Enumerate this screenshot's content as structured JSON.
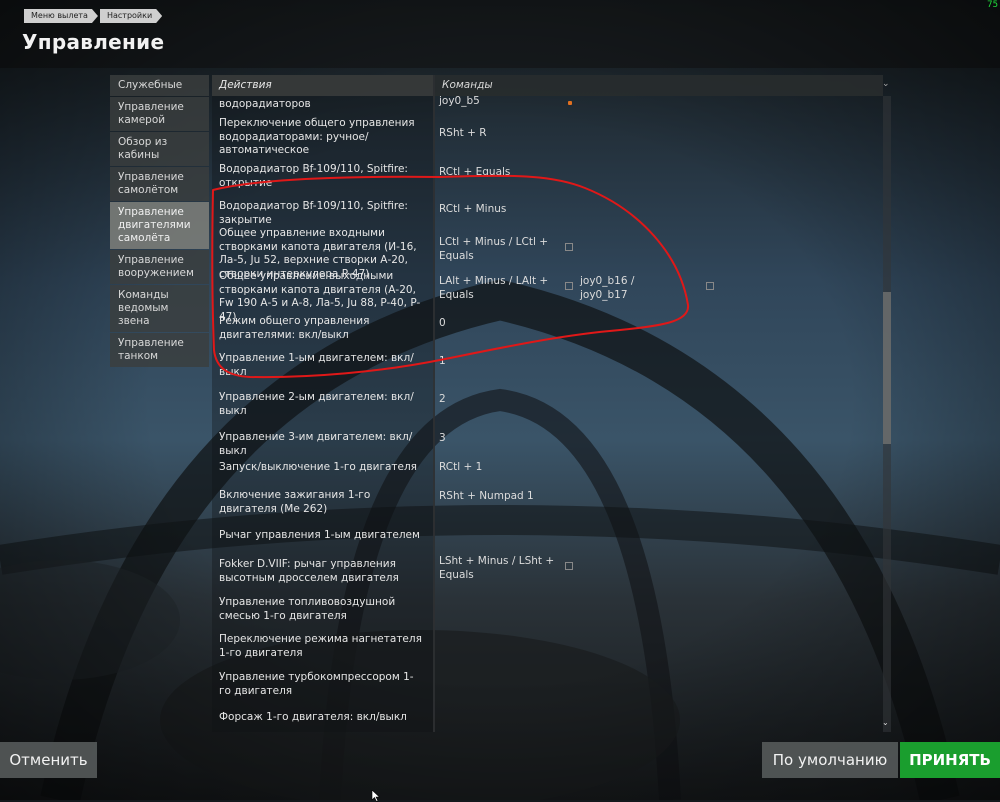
{
  "breadcrumb": [
    "Меню вылета",
    "Настройки"
  ],
  "page_title": "Управление",
  "fps": "75",
  "sidebar": {
    "items": [
      {
        "label": "Служебные",
        "active": false
      },
      {
        "label": "Управление камерой",
        "active": false
      },
      {
        "label": "Обзор из кабины",
        "active": false
      },
      {
        "label": "Управление самолётом",
        "active": false
      },
      {
        "label": "Управление двигателями самолёта",
        "active": true
      },
      {
        "label": "Управление вооружением",
        "active": false
      },
      {
        "label": "Команды ведомым звена",
        "active": false
      },
      {
        "label": "Управление танком",
        "active": false
      }
    ]
  },
  "table": {
    "header_actions": "Действия",
    "header_commands": "Команды",
    "rows": [
      {
        "action": "водорадиаторов",
        "key1": "joy0_b5",
        "key2": ""
      },
      {
        "action": "Переключение общего управления водорадиаторами: ручное/автоматическое",
        "key1": "RSht + R",
        "key2": ""
      },
      {
        "action": "Водорадиатор Bf-109/110, Spitfire: открытие",
        "key1": "RCtl + Equals",
        "key2": ""
      },
      {
        "action": "Водорадиатор Bf-109/110, Spitfire: закрытие",
        "key1": "RCtl + Minus",
        "key2": ""
      },
      {
        "action": "Общее управление входными створками капота двигателя (И-16, Ла-5, Ju 52, верхние створки А-20, створки интеркулера Р-47)",
        "key1": "LCtl + Minus / LCtl + Equals",
        "key2": ""
      },
      {
        "action": "Общее управление выходными створками капота двигателя (А-20, Fw 190 А-5 и А-8, Ла-5, Ju 88, P-40, P-47)",
        "key1": "LAlt + Minus / LAlt + Equals",
        "key2": "joy0_b16 / joy0_b17"
      },
      {
        "action": "Режим общего управления двигателями: вкл/выкл",
        "key1": "0",
        "key2": ""
      },
      {
        "action": "Управление 1-ым двигателем: вкл/выкл",
        "key1": "1",
        "key2": ""
      },
      {
        "action": "Управление 2-ым двигателем: вкл/выкл",
        "key1": "2",
        "key2": ""
      },
      {
        "action": "Управление 3-им двигателем: вкл/выкл",
        "key1": "3",
        "key2": ""
      },
      {
        "action": "Запуск/выключение 1-го двигателя",
        "key1": "RCtl + 1",
        "key2": ""
      },
      {
        "action": "Включение зажигания 1-го двигателя (Me 262)",
        "key1": "RSht + Numpad 1",
        "key2": ""
      },
      {
        "action": "Рычаг управления 1-ым двигателем",
        "key1": "",
        "key2": ""
      },
      {
        "action": "Fokker D.VIIF: рычаг управления высотным дросселем двигателя",
        "key1": "LSht + Minus / LSht + Equals",
        "key2": ""
      },
      {
        "action": "Управление топливовоздушной смесью 1-го двигателя",
        "key1": "",
        "key2": ""
      },
      {
        "action": "Переключение режима нагнетателя 1-го двигателя",
        "key1": "",
        "key2": ""
      },
      {
        "action": "Управление турбокомпрессором 1-го двигателя",
        "key1": "",
        "key2": ""
      },
      {
        "action": "Форсаж 1-го двигателя: вкл/выкл",
        "key1": "",
        "key2": ""
      }
    ]
  },
  "buttons": {
    "cancel": "Отменить",
    "default": "По умолчанию",
    "accept": "ПРИНЯТЬ"
  },
  "colors": {
    "accept_green": "#1a9e2e",
    "annotation_red": "#e01818",
    "fps_green": "#1fdc3a",
    "edit_orange": "#e07020"
  },
  "icons": [
    "edit-icon",
    "chevron-down-icon",
    "scroll-down-icon",
    "mouse-cursor-icon"
  ]
}
